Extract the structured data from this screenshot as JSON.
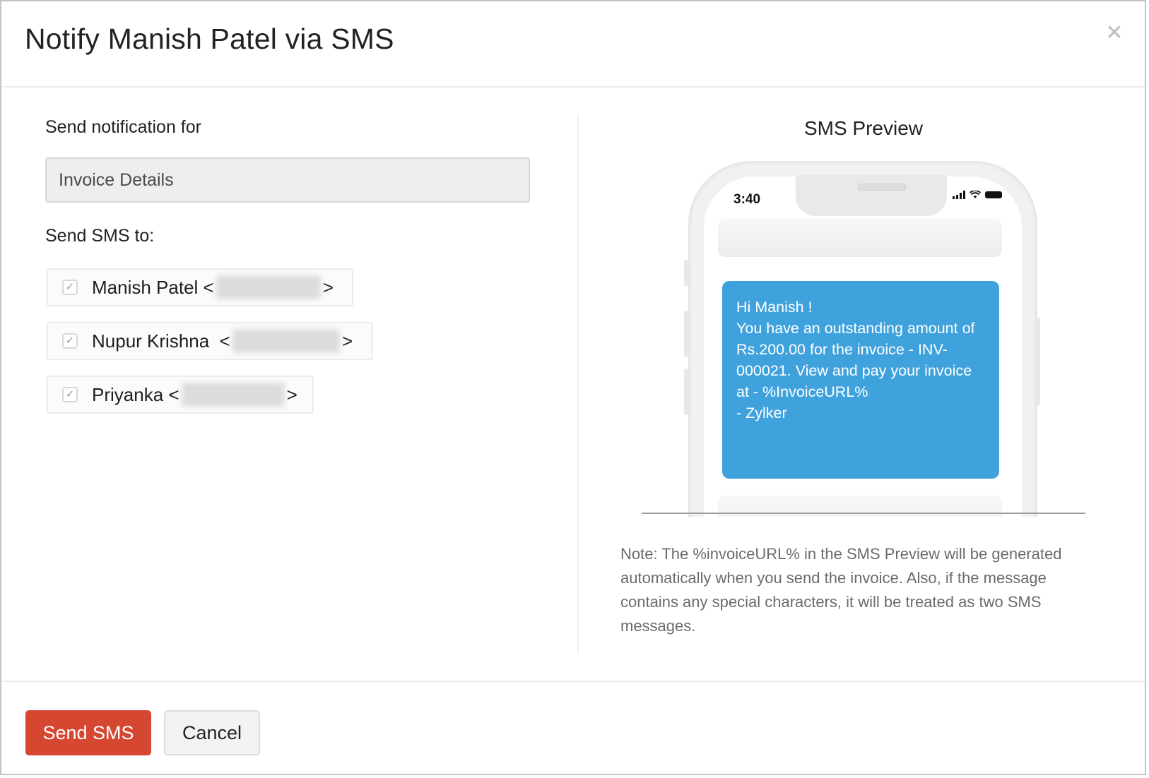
{
  "dialog": {
    "title": "Notify Manish Patel via SMS",
    "close_icon": "close-icon"
  },
  "form": {
    "notification_label": "Send notification for",
    "notification_value": "Invoice Details",
    "send_to_label": "Send SMS to:",
    "recipients": [
      {
        "name": "Manish Patel",
        "prefix": "Manish Patel <",
        "suffix": ">",
        "checked": true,
        "phone_redacted": true
      },
      {
        "name": "Nupur Krishna",
        "prefix": "Nupur Krishna  <",
        "suffix": ">",
        "checked": true,
        "phone_redacted": true
      },
      {
        "name": "Priyanka",
        "prefix": "Priyanka <",
        "suffix": ">",
        "checked": true,
        "phone_redacted": true
      }
    ]
  },
  "preview": {
    "title": "SMS Preview",
    "phone_time": "3:40",
    "status_icons": [
      "signal-icon",
      "wifi-icon",
      "battery-icon"
    ],
    "message_lines": [
      "Hi Manish !",
      "You have an outstanding amount of",
      "Rs.200.00 for the invoice - INV-",
      "000021. View and pay your invoice",
      "at - %InvoiceURL%",
      "- Zylker"
    ],
    "bubble_color": "#40a2dc",
    "note": "Note: The %invoiceURL% in the SMS Preview will be generated automatically when you send the invoice.  Also, if the message contains any special characters, it will be treated as two SMS messages."
  },
  "footer": {
    "send_label": "Send SMS",
    "cancel_label": "Cancel",
    "primary_color": "#d64731"
  }
}
